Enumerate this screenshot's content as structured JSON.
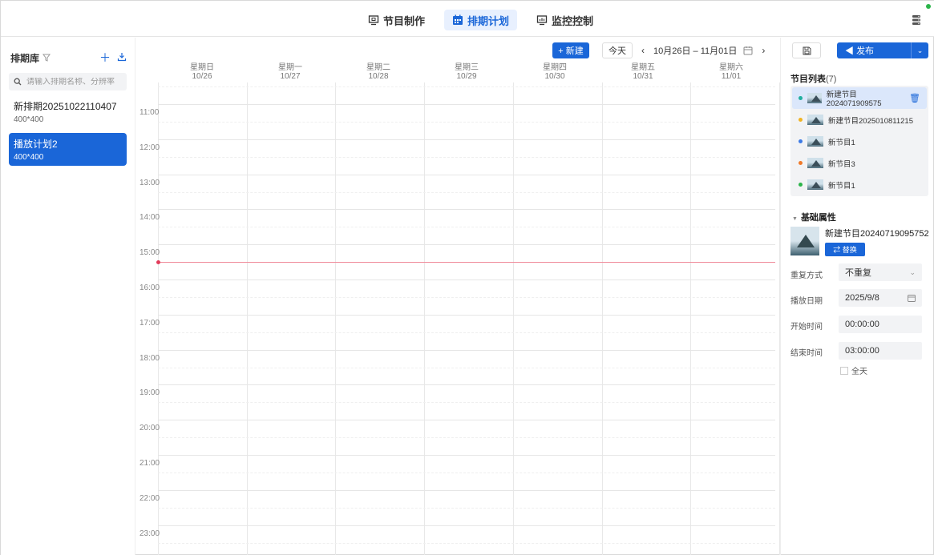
{
  "nav": {
    "tabs": [
      {
        "label": "节目制作",
        "icon": "monitor-icon"
      },
      {
        "label": "排期计划",
        "icon": "calendar-icon",
        "active": true
      },
      {
        "label": "监控控制",
        "icon": "dashboard-icon"
      }
    ]
  },
  "sidebar": {
    "title": "排期库",
    "search_placeholder": "请输入排期名称、分辨率",
    "schedules": [
      {
        "name": "新排期20251022110407",
        "size": "400*400"
      },
      {
        "name": "播放计划2",
        "size": "400*400",
        "active": true
      }
    ]
  },
  "toolbar": {
    "new_label": "+ 新建",
    "today_label": "今天",
    "prev": "‹",
    "next": "›",
    "range": "10月26日 – 11月01日"
  },
  "calendar": {
    "days": [
      {
        "weekday": "星期日",
        "date": "10/26"
      },
      {
        "weekday": "星期一",
        "date": "10/27"
      },
      {
        "weekday": "星期二",
        "date": "10/28"
      },
      {
        "weekday": "星期三",
        "date": "10/29"
      },
      {
        "weekday": "星期四",
        "date": "10/30"
      },
      {
        "weekday": "星期五",
        "date": "10/31"
      },
      {
        "weekday": "星期六",
        "date": "11/01"
      }
    ],
    "hours": [
      "11:00",
      "12:00",
      "13:00",
      "14:00",
      "15:00",
      "16:00",
      "17:00",
      "18:00",
      "19:00",
      "20:00",
      "21:00",
      "22:00",
      "23:00"
    ],
    "current_time_hour": 15.5
  },
  "right": {
    "publish_label": "发布",
    "program_list_title": "节目列表",
    "program_count": "(7)",
    "programs": [
      {
        "name": "新建节目2024071909575",
        "color": "#22b0a0",
        "active": true
      },
      {
        "name": "新建节目2025010811215",
        "color": "#f0b323"
      },
      {
        "name": "新节目1",
        "color": "#3d7be6"
      },
      {
        "name": "新节目3",
        "color": "#f07a2a"
      },
      {
        "name": "新节目1",
        "color": "#2bb54a"
      }
    ],
    "basic_title": "基础属性",
    "program_name": "新建节目20240719095752",
    "replace_label": "替换",
    "fields": {
      "repeat_label": "重复方式",
      "repeat_value": "不重复",
      "date_label": "播放日期",
      "date_value": "2025/9/8",
      "start_label": "开始时间",
      "start_value": "00:00:00",
      "end_label": "结束时间",
      "end_value": "03:00:00",
      "allday_label": "全天"
    }
  }
}
